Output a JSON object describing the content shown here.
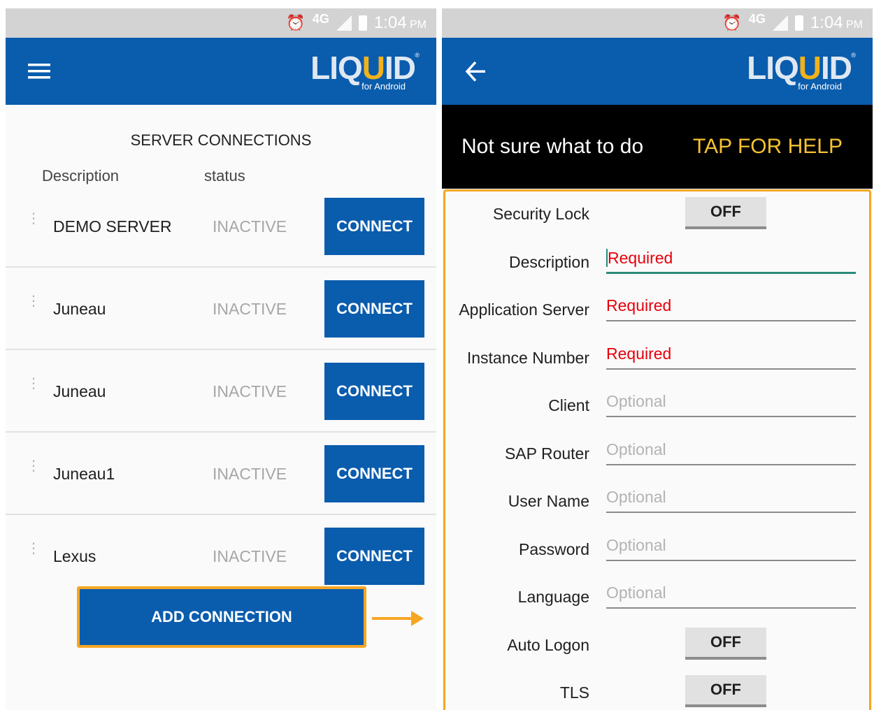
{
  "status_bar": {
    "network": "4G",
    "time": "1:04",
    "ampm": "PM"
  },
  "logo": {
    "text_a": "LIQ",
    "text_u": "U",
    "text_b": "ID",
    "tm": "®",
    "subtitle": "for Android"
  },
  "connections_screen": {
    "section_title": "SERVER CONNECTIONS",
    "col_description": "Description",
    "col_status": "status",
    "rows": [
      {
        "name": "DEMO SERVER",
        "status": "INACTIVE",
        "action": "CONNECT"
      },
      {
        "name": "Juneau",
        "status": "INACTIVE",
        "action": "CONNECT"
      },
      {
        "name": "Juneau",
        "status": "INACTIVE",
        "action": "CONNECT"
      },
      {
        "name": "Juneau1",
        "status": "INACTIVE",
        "action": "CONNECT"
      },
      {
        "name": "Lexus",
        "status": "INACTIVE",
        "action": "CONNECT"
      }
    ],
    "add_button": "ADD CONNECTION"
  },
  "form_screen": {
    "help_text": "Not sure what to do",
    "help_link": "TAP FOR HELP",
    "fields": [
      {
        "label": "Security Lock",
        "type": "toggle",
        "value": "OFF"
      },
      {
        "label": "Description",
        "type": "text",
        "placeholder": "Required"
      },
      {
        "label": "Application Server",
        "type": "text",
        "placeholder": "Required"
      },
      {
        "label": "Instance Number",
        "type": "text",
        "placeholder": "Required"
      },
      {
        "label": "Client",
        "type": "text",
        "placeholder": "Optional"
      },
      {
        "label": "SAP Router",
        "type": "text",
        "placeholder": "Optional"
      },
      {
        "label": "User Name",
        "type": "text",
        "placeholder": "Optional"
      },
      {
        "label": "Password",
        "type": "text",
        "placeholder": "Optional"
      },
      {
        "label": "Language",
        "type": "text",
        "placeholder": "Optional"
      },
      {
        "label": "Auto Logon",
        "type": "toggle",
        "value": "OFF"
      },
      {
        "label": "TLS",
        "type": "toggle",
        "value": "OFF"
      }
    ]
  },
  "colors": {
    "primary": "#0a5cad",
    "highlight": "#f5a623",
    "required": "#e8000b",
    "help_link": "#f5c232"
  },
  "icons": {
    "menu": "hamburger-icon",
    "back": "back-arrow-icon",
    "drag": "drag-handle-icon",
    "alarm": "alarm-icon"
  }
}
